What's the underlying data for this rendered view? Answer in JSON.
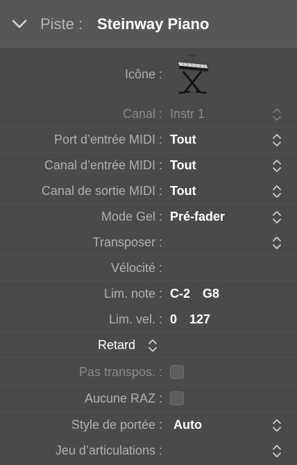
{
  "header": {
    "section_label": "Piste :",
    "track_name": "Steinway Piano"
  },
  "icon": {
    "label": "Icône :",
    "name": "keyboard-stand-icon"
  },
  "rows": {
    "canal": {
      "label": "Canal :",
      "value": "Instr 1"
    },
    "midi_in_port": {
      "label": "Port d’entrée MIDI :",
      "value": "Tout"
    },
    "midi_in_channel": {
      "label": "Canal d’entrée MIDI :",
      "value": "Tout"
    },
    "midi_out_channel": {
      "label": "Canal de sortie MIDI :",
      "value": "Tout"
    },
    "freeze_mode": {
      "label": "Mode Gel :",
      "value": "Pré-fader"
    },
    "transpose": {
      "label": "Transposer :",
      "value": ""
    },
    "velocity": {
      "label": "Vélocité :",
      "value": ""
    },
    "note_limit": {
      "label": "Lim. note :",
      "low": "C-2",
      "high": "G8"
    },
    "velocity_limit": {
      "label": "Lim. vel. :",
      "low": "0",
      "high": "127"
    },
    "delay": {
      "label": "Retard"
    },
    "no_transpose": {
      "label": "Pas transpos. :",
      "checked": false
    },
    "no_reset": {
      "label": "Aucune RAZ :",
      "checked": false
    },
    "staff_style": {
      "label": "Style de portée :",
      "value": "Auto"
    },
    "articulation_set": {
      "label": "Jeu d’articulations :",
      "value": ""
    }
  },
  "colors": {
    "background": "#4a4a4a",
    "header_background": "#575757",
    "label_text": "#b0b0b0",
    "value_text": "#ffffff",
    "disabled_text": "#8a8a8a"
  }
}
